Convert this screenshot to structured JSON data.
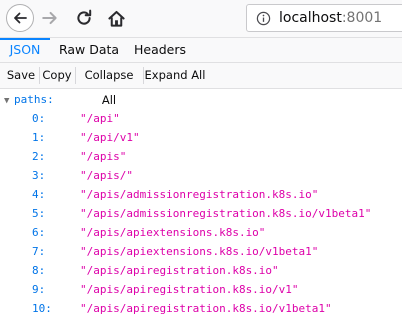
{
  "browser": {
    "url_host": "localhost",
    "url_port": ":8001"
  },
  "tabs": [
    {
      "label": "JSON",
      "active": true
    },
    {
      "label": "Raw Data",
      "active": false
    },
    {
      "label": "Headers",
      "active": false
    }
  ],
  "actions": {
    "save": "Save",
    "copy": "Copy",
    "collapse_all": "Collapse All",
    "expand_all": "Expand All"
  },
  "json": {
    "root_key": "paths:",
    "items": [
      {
        "index": "0:",
        "value": "\"/api\""
      },
      {
        "index": "1:",
        "value": "\"/api/v1\""
      },
      {
        "index": "2:",
        "value": "\"/apis\""
      },
      {
        "index": "3:",
        "value": "\"/apis/\""
      },
      {
        "index": "4:",
        "value": "\"/apis/admissionregistration.k8s.io\""
      },
      {
        "index": "5:",
        "value": "\"/apis/admissionregistration.k8s.io/v1beta1\""
      },
      {
        "index": "6:",
        "value": "\"/apis/apiextensions.k8s.io\""
      },
      {
        "index": "7:",
        "value": "\"/apis/apiextensions.k8s.io/v1beta1\""
      },
      {
        "index": "8:",
        "value": "\"/apis/apiregistration.k8s.io\""
      },
      {
        "index": "9:",
        "value": "\"/apis/apiregistration.k8s.io/v1\""
      },
      {
        "index": "10:",
        "value": "\"/apis/apiregistration.k8s.io/v1beta1\""
      }
    ]
  },
  "colors": {
    "accent": "#0a84ff",
    "key": "#0074e8",
    "string": "#dd00a9"
  }
}
